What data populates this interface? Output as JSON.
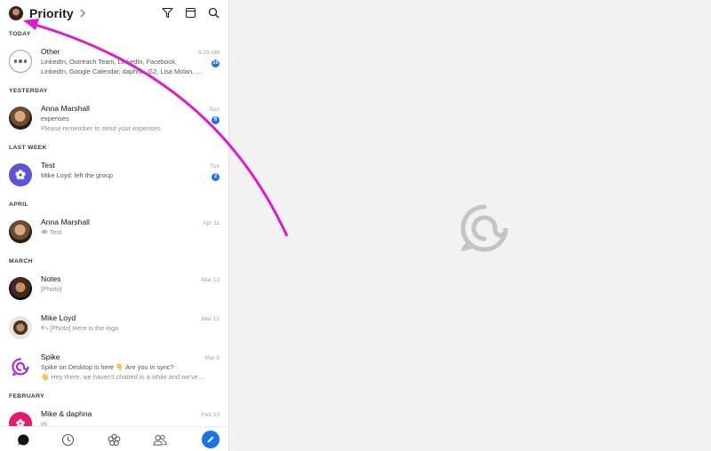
{
  "header": {
    "title": "Priority"
  },
  "sections": {
    "today": "TODAY",
    "yesterday": "YESTERDAY",
    "last_week": "LAST WEEK",
    "april": "APRIL",
    "march": "MARCH",
    "february": "FEBRUARY"
  },
  "conversations": [
    {
      "name": "Other",
      "time": "6:29 AM",
      "line1": "LinkedIn, Outreach Team, LinkedIn, Facebook,",
      "line2": "LinkedIn, Google Calendar, daphna, G2, Lisa Molan, …",
      "badge": "10"
    },
    {
      "name": "Anna Marshall",
      "time": "Sun",
      "line1": "expenses",
      "line2": "Please remember to send your expenses",
      "badge": "6"
    },
    {
      "name": "Test",
      "time": "Tue",
      "line1": "Mike Loyd: left the group",
      "badge": "2"
    },
    {
      "name": "Anna Marshall",
      "time": "Apr 11",
      "line1": "Test"
    },
    {
      "name": "Notes",
      "time": "Mar 12",
      "line1": "[Photo]"
    },
    {
      "name": "Mike Loyd",
      "time": "Mar 12",
      "line1": "[Photo] Here is the logo"
    },
    {
      "name": "Spike",
      "time": "Mar 5",
      "line1": "Spike on Desktop is here 👇 Are you in sync?",
      "line2": "👋 Hey there, we haven't chatted in a while and we've…"
    },
    {
      "name": "Mike & daphna",
      "time": "Feb 13",
      "line1": "Hi"
    }
  ],
  "colors": {
    "accent": "#1a73e8",
    "arrow": "#e01ad0",
    "spike_purple": "#b02ae0",
    "daphna_pink": "#e6196f",
    "test_purple": "#5b54d6"
  },
  "icons": {
    "filter": "filter-icon",
    "calendar": "calendar-icon",
    "search": "search-icon",
    "chats": "chat-bubble-icon",
    "later": "clock-icon",
    "groups": "groups-icon",
    "contacts": "contacts-icon",
    "compose": "pencil-icon"
  }
}
